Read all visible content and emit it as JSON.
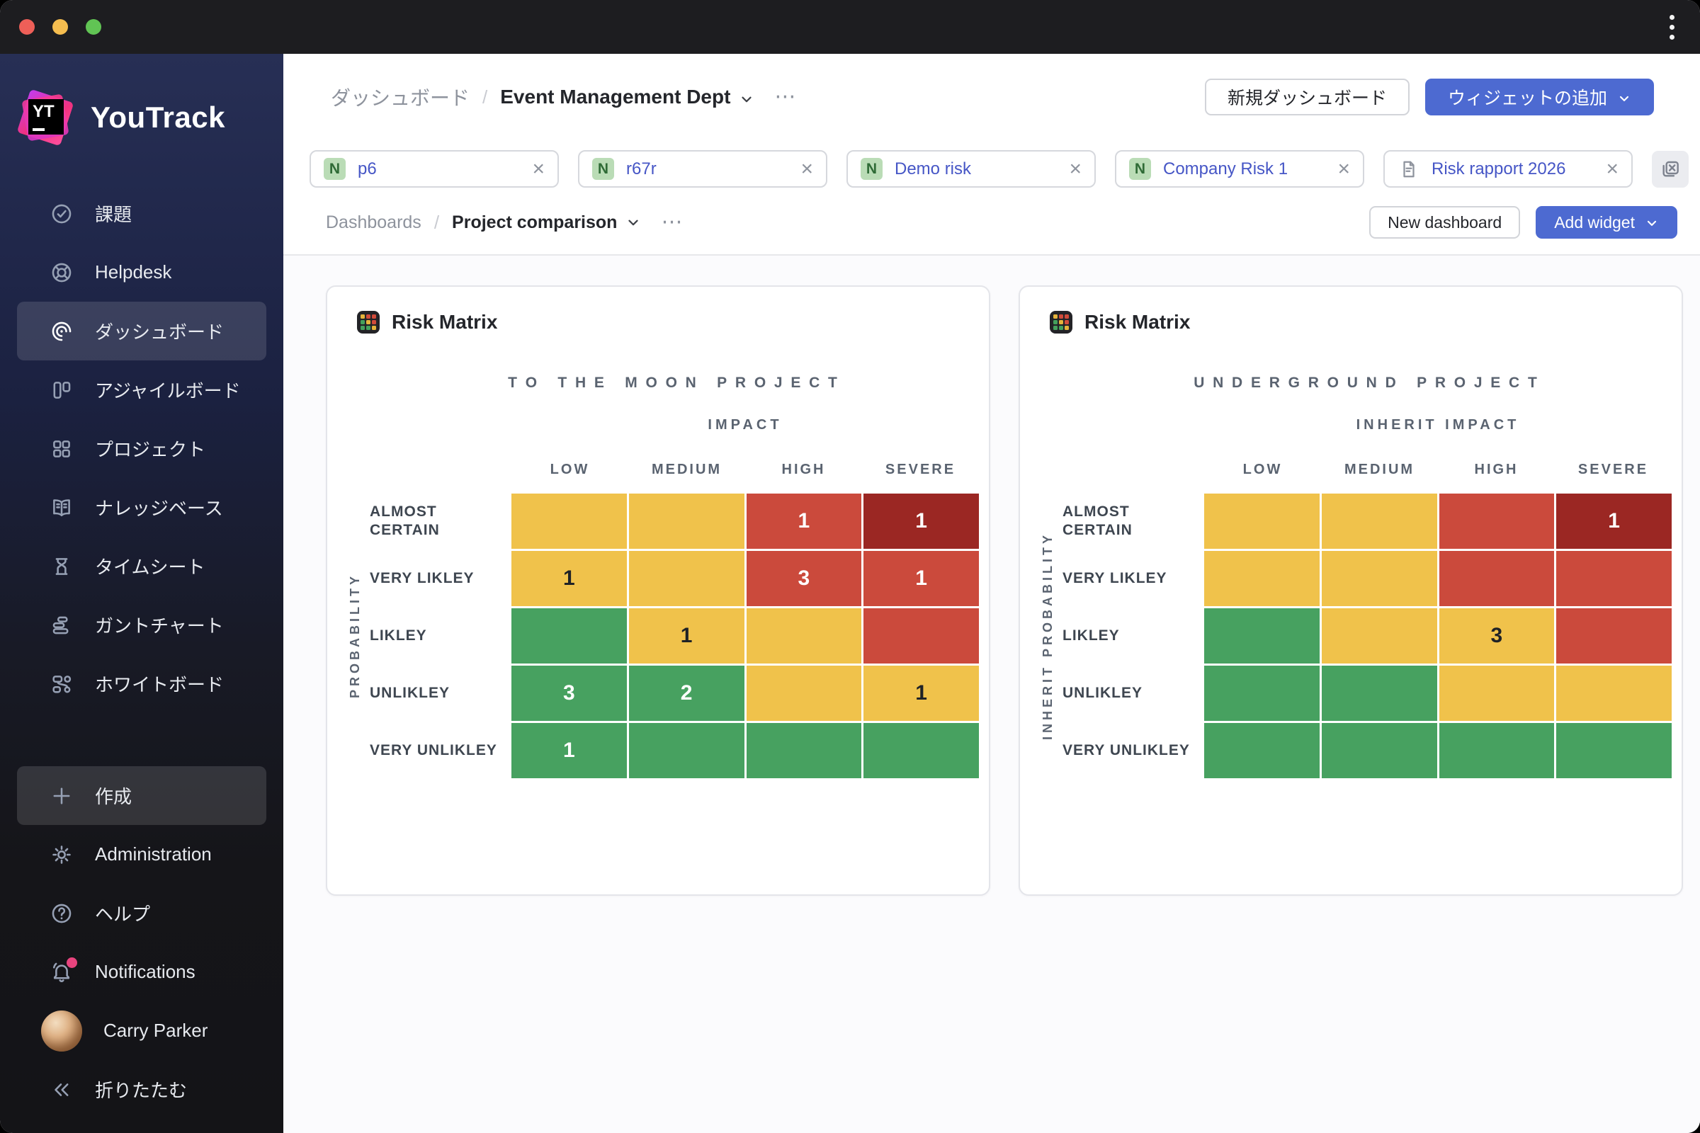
{
  "titlebar": {
    "kebab_icon": "kebab-menu"
  },
  "sidebar": {
    "logo_text": "YouTrack",
    "items": [
      {
        "label": "課題",
        "icon": "tasks-icon",
        "active": false
      },
      {
        "label": "Helpdesk",
        "icon": "helpdesk-icon",
        "active": false
      },
      {
        "label": "ダッシュボード",
        "icon": "dashboards-icon",
        "active": true
      },
      {
        "label": "アジャイルボード",
        "icon": "agile-board-icon",
        "active": false
      },
      {
        "label": "プロジェクト",
        "icon": "projects-icon",
        "active": false
      },
      {
        "label": "ナレッジベース",
        "icon": "knowledge-base-icon",
        "active": false
      },
      {
        "label": "タイムシート",
        "icon": "timesheet-icon",
        "active": false
      },
      {
        "label": "ガントチャート",
        "icon": "gantt-chart-icon",
        "active": false
      },
      {
        "label": "ホワイトボード",
        "icon": "whiteboard-icon",
        "active": false
      }
    ],
    "bottom_items": [
      {
        "label": "作成",
        "icon": "plus-icon",
        "highlight": true
      },
      {
        "label": "Administration",
        "icon": "gear-icon"
      },
      {
        "label": "ヘルプ",
        "icon": "help-icon"
      },
      {
        "label": "Notifications",
        "icon": "bell-icon",
        "badge": true
      },
      {
        "label": "Carry Parker",
        "icon": "avatar"
      },
      {
        "label": "折りたたむ",
        "icon": "collapse-icon"
      }
    ]
  },
  "header": {
    "breadcrumb_root": "ダッシュボード",
    "breadcrumb_current": "Event Management Dept",
    "new_dashboard_button": "新規ダッシュボード",
    "add_widget_button": "ウィジェットの追加"
  },
  "filters": {
    "tags": [
      {
        "badge": "N",
        "label": "p6"
      },
      {
        "badge": "N",
        "label": "r67r"
      },
      {
        "badge": "N",
        "label": "Demo risk"
      },
      {
        "badge": "N",
        "label": "Company Risk 1"
      },
      {
        "badge": "doc",
        "label": "Risk rapport 2026"
      }
    ],
    "clear_all_icon": "remove-all-filters"
  },
  "subheader": {
    "breadcrumb_root": "Dashboards",
    "breadcrumb_current": "Project comparison",
    "new_dashboard_button": "New dashboard",
    "add_widget_button": "Add widget"
  },
  "widgets": [
    {
      "title": "Risk Matrix",
      "project_title": "TO THE MOON PROJECT",
      "impact_label": "IMPACT",
      "probability_label": "PROBABILITY",
      "columns": [
        "LOW",
        "MEDIUM",
        "HIGH",
        "SEVERE"
      ],
      "rows": [
        "ALMOST CERTAIN",
        "VERY LIKLEY",
        "LIKLEY",
        "UNLIKLEY",
        "VERY UNLIKLEY"
      ],
      "cells": [
        [
          [
            "y",
            ""
          ],
          [
            "y",
            ""
          ],
          [
            "r",
            "1"
          ],
          [
            "dr",
            "1"
          ]
        ],
        [
          [
            "y",
            "1"
          ],
          [
            "y",
            ""
          ],
          [
            "r",
            "3"
          ],
          [
            "r",
            "1"
          ]
        ],
        [
          [
            "g",
            ""
          ],
          [
            "y",
            "1"
          ],
          [
            "y",
            ""
          ],
          [
            "r",
            ""
          ]
        ],
        [
          [
            "g",
            "3"
          ],
          [
            "g",
            "2"
          ],
          [
            "y",
            ""
          ],
          [
            "y",
            "1"
          ]
        ],
        [
          [
            "g",
            "1"
          ],
          [
            "g",
            ""
          ],
          [
            "g",
            ""
          ],
          [
            "g",
            ""
          ]
        ]
      ]
    },
    {
      "title": "Risk Matrix",
      "project_title": "UNDERGROUND PROJECT",
      "impact_label": "INHERIT IMPACT",
      "probability_label": "INHERIT PROBABILITY",
      "columns": [
        "LOW",
        "MEDIUM",
        "HIGH",
        "SEVERE"
      ],
      "rows": [
        "ALMOST CERTAIN",
        "VERY LIKLEY",
        "LIKLEY",
        "UNLIKLEY",
        "VERY UNLIKLEY"
      ],
      "cells": [
        [
          [
            "y",
            ""
          ],
          [
            "y",
            ""
          ],
          [
            "r",
            ""
          ],
          [
            "dr",
            "1"
          ]
        ],
        [
          [
            "y",
            ""
          ],
          [
            "y",
            ""
          ],
          [
            "r",
            ""
          ],
          [
            "r",
            ""
          ]
        ],
        [
          [
            "g",
            ""
          ],
          [
            "y",
            ""
          ],
          [
            "y",
            "3"
          ],
          [
            "r",
            ""
          ]
        ],
        [
          [
            "g",
            ""
          ],
          [
            "g",
            ""
          ],
          [
            "y",
            ""
          ],
          [
            "y",
            ""
          ]
        ],
        [
          [
            "g",
            ""
          ],
          [
            "g",
            ""
          ],
          [
            "g",
            ""
          ],
          [
            "g",
            ""
          ]
        ]
      ]
    }
  ],
  "colors": {
    "yellow": "#F0C24B",
    "red": "#CB4A3C",
    "dark_red": "#9B2723",
    "green": "#47A160",
    "accent_blue": "#4D6AD1",
    "tag_link": "#4656C6",
    "badge_green_bg": "#BADCB6",
    "badge_green_text": "#2F6B36",
    "notification_dot": "#E8447E"
  }
}
